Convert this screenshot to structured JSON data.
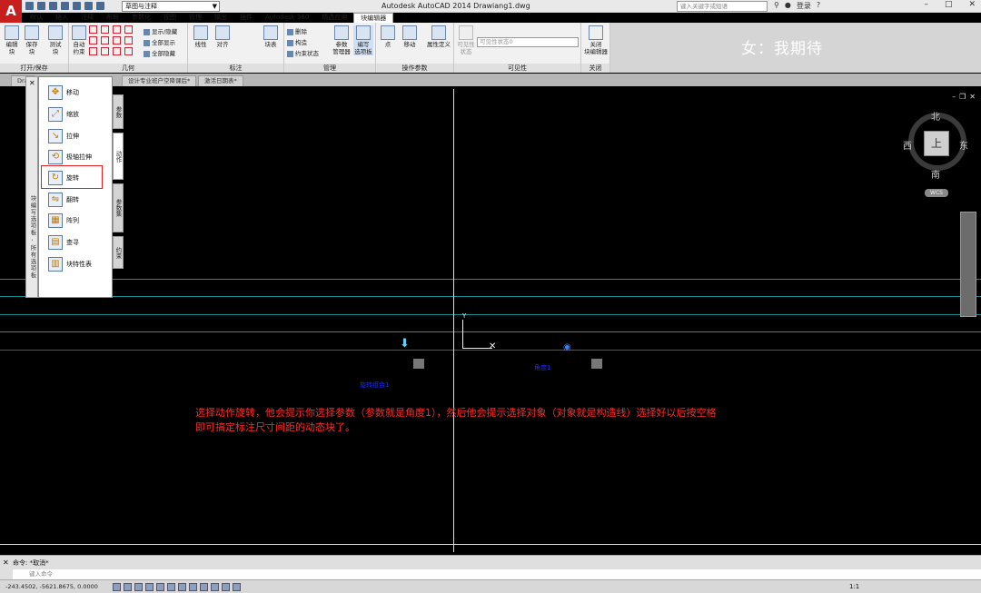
{
  "title_bar": {
    "app_title": "Autodesk AutoCAD 2014   Drawiang1.dwg",
    "workspace": "草图与注释",
    "search_placeholder": "键入关键字或短语",
    "login": "登录"
  },
  "ribbon_tabs": [
    "默认",
    "插入",
    "注释",
    "布局",
    "参数化",
    "视图",
    "管理",
    "输出",
    "插件",
    "Autodesk 360",
    "精选应用",
    "块编辑器"
  ],
  "ribbon": {
    "open_save": {
      "title": "打开/保存",
      "edit_block": "编辑\n块",
      "save_block": "保存\n块"
    },
    "test_block": "测试\n块",
    "geometry": {
      "title": "几何",
      "auto": "自动\n约束",
      "show_hide": "显示/隐藏",
      "show_all": "全部显示",
      "hide_all": "全部隐藏"
    },
    "dimension": {
      "title": "标注",
      "linear": "线性",
      "align": "对齐",
      "block_table": "块表"
    },
    "manage": {
      "title": "管理",
      "delete": "删除",
      "construct": "构造",
      "constraint_state": "约束状态",
      "param_manager": "参数\n管理器",
      "authoring": "编写\n选项板"
    },
    "action_params": {
      "title": "操作参数",
      "point": "点",
      "move": "移动",
      "attr_def": "属性定义"
    },
    "visibility": {
      "title": "可见性",
      "visible": "可见性\n状态",
      "state_placeholder": "可见性状态0"
    },
    "close": {
      "title": "关闭",
      "close_editor": "关闭\n块编辑器"
    }
  },
  "ribbon_note": "女：我期待",
  "doc_tabs": [
    "Dra",
    "设计专业班户空降课后*",
    "激活日期表*"
  ],
  "palette": {
    "vertical_title": "块编写选项板 - 所有选项板",
    "tabs": [
      "参数",
      "动作",
      "参数集",
      "约束"
    ],
    "items": [
      "移动",
      "缩放",
      "拉伸",
      "极轴拉伸",
      "旋转",
      "翻转",
      "阵列",
      "查寻",
      "块特性表"
    ]
  },
  "drawing": {
    "ucs_y": "Y",
    "label_left": "旋转组合1",
    "label_right": "角度1",
    "tip_line1": "选择动作旋转，他会提示你选择参数（参数就是角度1），然后他会提示选择对象（对象就是构造线）选择好以后按空格",
    "tip_line2": "即可搞定标注尺寸间距的动态块了。"
  },
  "viewcube": {
    "north": "北",
    "south": "南",
    "east": "东",
    "west": "西",
    "top": "上",
    "wcs": "WCS"
  },
  "command": {
    "history": "命令: *取消*",
    "placeholder": "键入命令"
  },
  "status": {
    "coords": "-243.4502,  -5621.8675,  0.0000",
    "scale": "1:1"
  },
  "colors": {
    "accent": "#c81e1e",
    "highlight": "#e02020",
    "dim_line": "#1a2cff",
    "tip_text": "#ff2a2a"
  }
}
